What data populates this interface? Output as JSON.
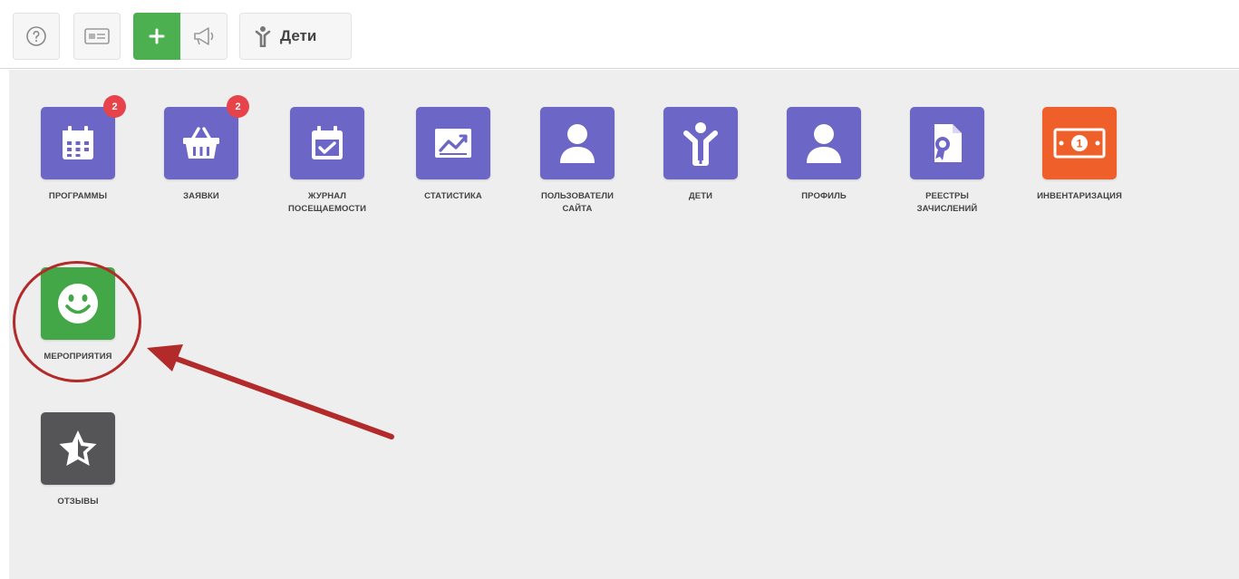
{
  "toolbar": {
    "help_icon": "help-circle-icon",
    "card_icon": "id-card-icon",
    "add_icon": "plus-icon",
    "announce_icon": "megaphone-icon",
    "children_label": "Дети"
  },
  "tiles": [
    {
      "label": "ПРОГРАММЫ",
      "icon": "calendar-icon",
      "badge": "2",
      "color": "#6c66c6"
    },
    {
      "label": "ЗАЯВКИ",
      "icon": "basket-icon",
      "badge": "2",
      "color": "#6c66c6"
    },
    {
      "label_line1": "ЖУРНАЛ",
      "label_line2": "ПОСЕЩАЕМОСТИ",
      "icon": "calendar-check-icon",
      "color": "#6c66c6"
    },
    {
      "label": "СТАТИСТИКА",
      "icon": "chart-icon",
      "color": "#6c66c6"
    },
    {
      "label_line1": "ПОЛЬЗОВАТЕЛИ",
      "label_line2": "САЙТА",
      "icon": "user-icon",
      "color": "#6c66c6"
    },
    {
      "label": "ДЕТИ",
      "icon": "child-icon",
      "color": "#6c66c6"
    },
    {
      "label": "ПРОФИЛЬ",
      "icon": "user-icon",
      "color": "#6c66c6"
    },
    {
      "label_line1": "РЕЕСТРЫ",
      "label_line2": "ЗАЧИСЛЕНИЙ",
      "icon": "certificate-icon",
      "color": "#6c66c6"
    },
    {
      "label": "ИНВЕНТАРИЗАЦИЯ",
      "icon": "money-icon",
      "color": "#ef5f2a"
    },
    {
      "label": "МЕРОПРИЯТИЯ",
      "icon": "smile-icon",
      "color": "#43a647"
    },
    {
      "label": "ОТЗЫВЫ",
      "icon": "star-icon",
      "color": "#555558"
    }
  ],
  "annotation": {
    "color": "#b22a2a"
  }
}
